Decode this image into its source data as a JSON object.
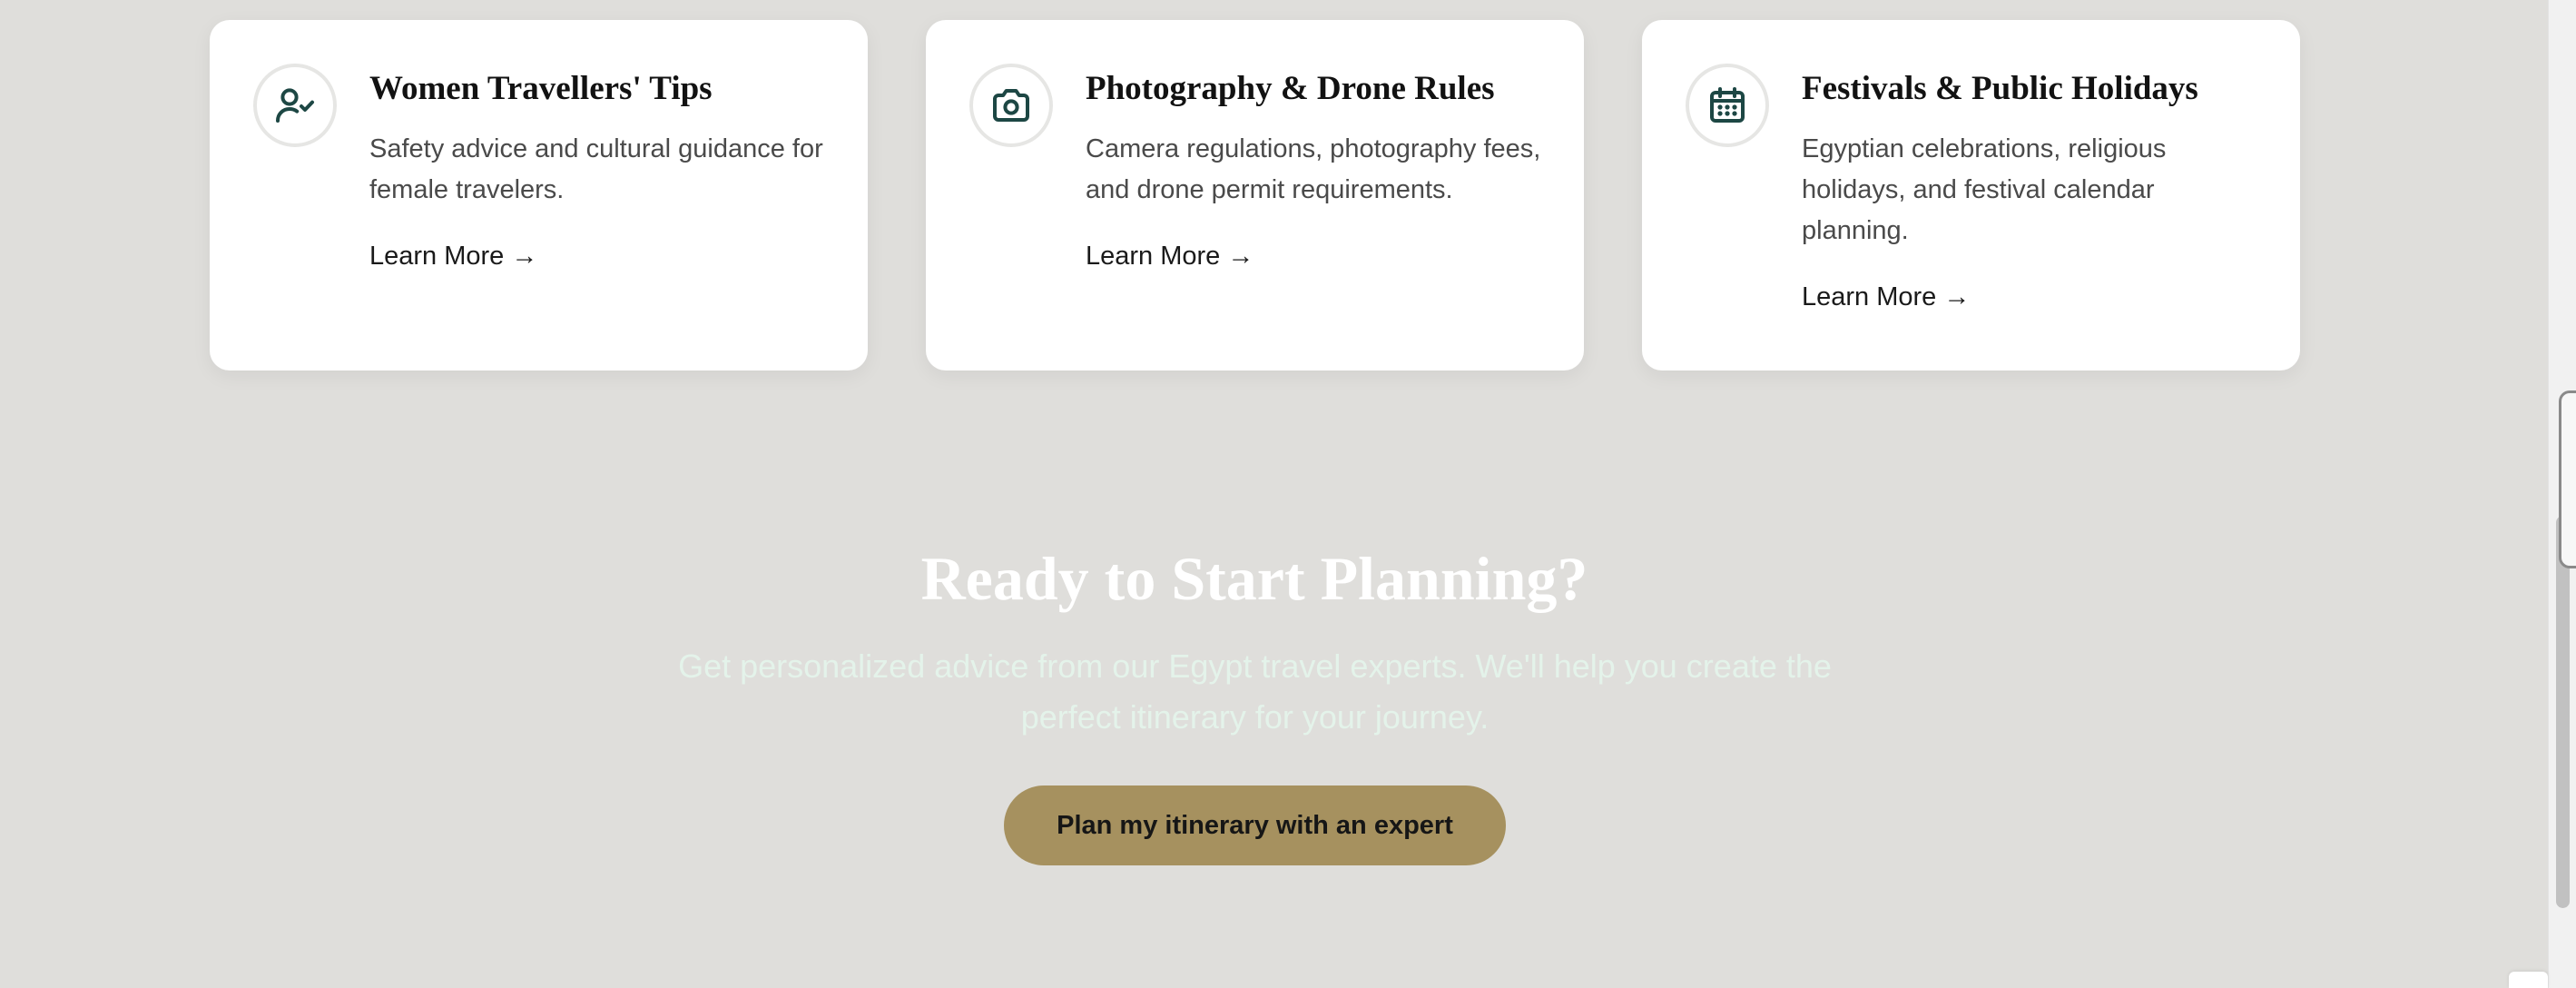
{
  "cards": [
    {
      "icon": "user-check-icon",
      "title": "Women Travellers' Tips",
      "description": "Safety advice and cultural guidance for female travelers.",
      "link": "Learn More →"
    },
    {
      "icon": "camera-icon",
      "title": "Photography & Drone Rules",
      "description": "Camera regulations, photography fees, and drone permit requirements.",
      "link": "Learn More →"
    },
    {
      "icon": "calendar-icon",
      "title": "Festivals & Public Holidays",
      "description": "Egyptian celebrations, religious holidays, and festival calendar planning.",
      "link": "Learn More →"
    }
  ],
  "cta": {
    "title": "Ready to Start Planning?",
    "subtitle": "Get personalized advice from our Egypt travel experts. We'll help you create the perfect itinerary for your journey.",
    "button": "Plan my itinerary with an expert"
  },
  "colors": {
    "background": "#dfdedb",
    "card": "#ffffff",
    "icon_stroke": "#1d4744",
    "button": "#a6915f",
    "cta_title": "#ffffff",
    "cta_subtitle": "#e4f3ea"
  }
}
